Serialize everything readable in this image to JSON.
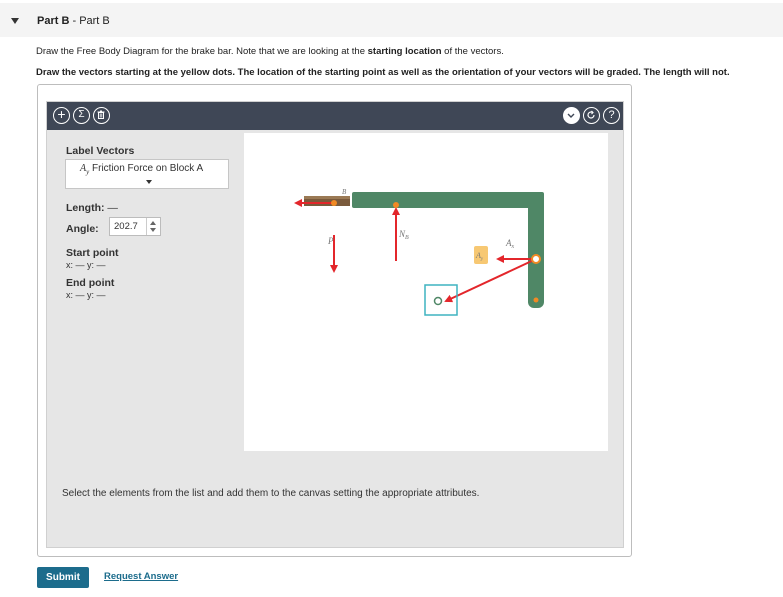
{
  "part": {
    "label": "Part B",
    "sep": " - ",
    "name": "Part B"
  },
  "instructions": {
    "line1_pre": "Draw the Free Body Diagram for the brake bar. Note that we are looking at the ",
    "line1_bold": "starting location",
    "line1_post": " of the vectors.",
    "line2": "Draw the vectors starting at the yellow dots. The location of the starting point as well as the orientation of your vectors will be graded. The length will not."
  },
  "toolbar": {
    "add_icon": "plus-icon",
    "sum_icon": "sigma-icon",
    "trash_icon": "trash-icon",
    "chevron_icon": "chevron-down-icon",
    "reset_icon": "reset-icon",
    "help_icon": "help-icon",
    "help_glyph": "?",
    "sum_glyph": "Σ",
    "add_glyph": "+"
  },
  "panel": {
    "label_vectors": "Label Vectors",
    "selected_vector_symbol": "A",
    "selected_vector_sub": "y",
    "selected_vector_text": "Friction Force on Block A",
    "length_label": "Length:",
    "length_value": "—",
    "angle_label": "Angle:",
    "angle_value": "202.7",
    "start_label": "Start point",
    "start_coords": "x: — y: —",
    "end_label": "End point",
    "end_coords": "x: — y: —"
  },
  "canvas": {
    "labels": {
      "P": "P",
      "N_B": "N",
      "N_B_sub": "B",
      "A_x": "A",
      "A_x_sub": "x",
      "A_y": "A",
      "A_y_sub": "y",
      "B_top": "B"
    },
    "colors": {
      "bar": "#4f8766",
      "vector": "#e3262b",
      "dot": "#f08a24",
      "block": "#7a5a3c",
      "selection_box": "#3fb3c0",
      "label_highlight": "#f7c873"
    }
  },
  "status_text": "Select the elements from the list and add them to the canvas setting the appropriate attributes.",
  "actions": {
    "submit": "Submit",
    "request_answer": "Request Answer"
  }
}
